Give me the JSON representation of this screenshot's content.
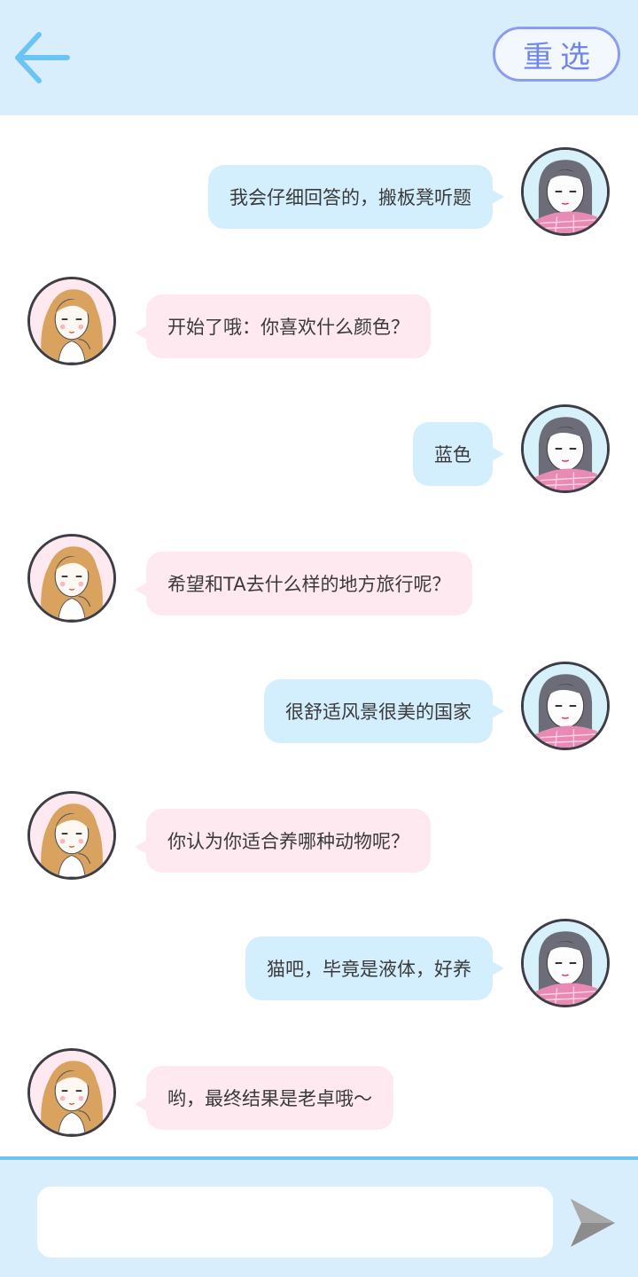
{
  "header": {
    "back_icon": "arrow-left-icon",
    "reselect_label": "重选",
    "colors": {
      "background": "#d8eefc",
      "accent": "#6f86ea",
      "arrow": "#6cc4f5"
    }
  },
  "messages": [
    {
      "side": "right",
      "avatar": "dark-hair-girl-avatar",
      "text": "我会仔细回答的，搬板凳听题"
    },
    {
      "side": "left",
      "avatar": "blonde-girl-avatar",
      "text": "开始了哦：你喜欢什么颜色？"
    },
    {
      "side": "right",
      "avatar": "dark-hair-girl-avatar",
      "text": "蓝色"
    },
    {
      "side": "left",
      "avatar": "blonde-girl-avatar",
      "text": "希望和TA去什么样的地方旅行呢？"
    },
    {
      "side": "right",
      "avatar": "dark-hair-girl-avatar",
      "text": "很舒适风景很美的国家"
    },
    {
      "side": "left",
      "avatar": "blonde-girl-avatar",
      "text": "你认为你适合养哪种动物呢？"
    },
    {
      "side": "right",
      "avatar": "dark-hair-girl-avatar",
      "text": "猫吧，毕竟是液体，好养"
    },
    {
      "side": "left",
      "avatar": "blonde-girl-avatar",
      "text": "哟，最终结果是老卓哦～"
    }
  ],
  "bubble_colors": {
    "right": "#d3eefd",
    "left": "#fde9ef"
  },
  "input": {
    "value": "",
    "placeholder": ""
  },
  "send_icon": "send-arrow-icon"
}
